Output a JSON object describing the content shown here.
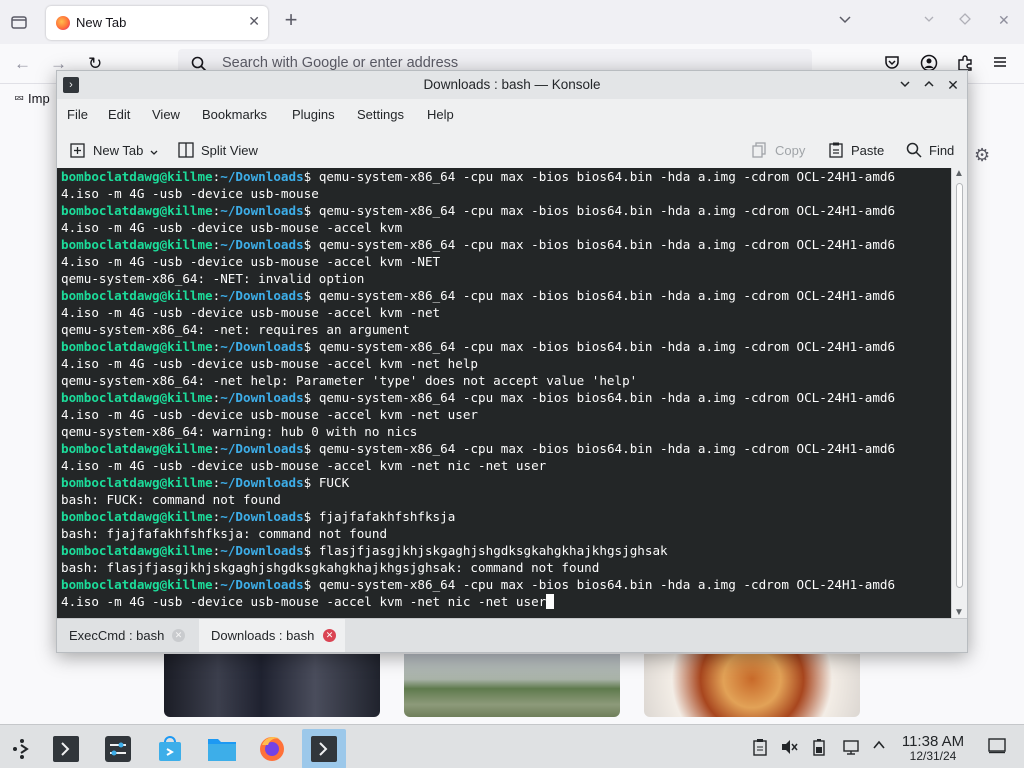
{
  "firefox": {
    "tab_title": "New Tab",
    "url_placeholder": "Search with Google or enter address",
    "bookmark_partial": "Imp"
  },
  "konsole": {
    "title": "Downloads : bash — Konsole",
    "menu": [
      "File",
      "Edit",
      "View",
      "Bookmarks",
      "Plugins",
      "Settings",
      "Help"
    ],
    "toolbar": {
      "new_tab": "New Tab",
      "split_view": "Split View",
      "copy": "Copy",
      "paste": "Paste",
      "find": "Find"
    },
    "prompt": {
      "user_host": "bomboclatdawg@killme",
      "colon": ":",
      "path": "~/Downloads",
      "dollar": "$ "
    },
    "terminal_lines": [
      {
        "type": "prompt",
        "text": "qemu-system-x86_64 -cpu max -bios bios64.bin -hda a.img -cdrom OCL-24H1-amd6"
      },
      {
        "type": "output",
        "text": "4.iso -m 4G -usb -device usb-mouse"
      },
      {
        "type": "prompt",
        "text": "qemu-system-x86_64 -cpu max -bios bios64.bin -hda a.img -cdrom OCL-24H1-amd6"
      },
      {
        "type": "output",
        "text": "4.iso -m 4G -usb -device usb-mouse -accel kvm"
      },
      {
        "type": "prompt",
        "text": "qemu-system-x86_64 -cpu max -bios bios64.bin -hda a.img -cdrom OCL-24H1-amd6"
      },
      {
        "type": "output",
        "text": "4.iso -m 4G -usb -device usb-mouse -accel kvm -NET"
      },
      {
        "type": "output",
        "text": "qemu-system-x86_64: -NET: invalid option"
      },
      {
        "type": "prompt",
        "text": "qemu-system-x86_64 -cpu max -bios bios64.bin -hda a.img -cdrom OCL-24H1-amd6"
      },
      {
        "type": "output",
        "text": "4.iso -m 4G -usb -device usb-mouse -accel kvm -net"
      },
      {
        "type": "output",
        "text": "qemu-system-x86_64: -net: requires an argument"
      },
      {
        "type": "prompt",
        "text": "qemu-system-x86_64 -cpu max -bios bios64.bin -hda a.img -cdrom OCL-24H1-amd6"
      },
      {
        "type": "output",
        "text": "4.iso -m 4G -usb -device usb-mouse -accel kvm -net help"
      },
      {
        "type": "output",
        "text": "qemu-system-x86_64: -net help: Parameter 'type' does not accept value 'help'"
      },
      {
        "type": "prompt",
        "text": "qemu-system-x86_64 -cpu max -bios bios64.bin -hda a.img -cdrom OCL-24H1-amd6"
      },
      {
        "type": "output",
        "text": "4.iso -m 4G -usb -device usb-mouse -accel kvm -net user"
      },
      {
        "type": "output",
        "text": "qemu-system-x86_64: warning: hub 0 with no nics"
      },
      {
        "type": "prompt",
        "text": "qemu-system-x86_64 -cpu max -bios bios64.bin -hda a.img -cdrom OCL-24H1-amd6"
      },
      {
        "type": "output",
        "text": "4.iso -m 4G -usb -device usb-mouse -accel kvm -net nic -net user"
      },
      {
        "type": "prompt",
        "text": "FUCK"
      },
      {
        "type": "output",
        "text": "bash: FUCK: command not found"
      },
      {
        "type": "prompt",
        "text": "fjajfafakhfshfksja"
      },
      {
        "type": "output",
        "text": "bash: fjajfafakhfshfksja: command not found"
      },
      {
        "type": "prompt",
        "text": "flasjfjasgjkhjskgaghjshgdksgkahgkhajkhgsjghsak"
      },
      {
        "type": "output",
        "text": "bash: flasjfjasgjkhjskgaghjshgdksgkahgkhajkhgsjghsak: command not found"
      },
      {
        "type": "prompt",
        "text": "qemu-system-x86_64 -cpu max -bios bios64.bin -hda a.img -cdrom OCL-24H1-amd6"
      },
      {
        "type": "output",
        "text": "4.iso -m 4G -usb -device usb-mouse -accel kvm -net nic -net user",
        "cursor": true
      }
    ],
    "tabs": [
      {
        "label": "ExecCmd : bash",
        "active": false
      },
      {
        "label": "Downloads : bash",
        "active": true
      }
    ]
  },
  "panel": {
    "clock_time": "11:38 AM",
    "clock_date": "12/31/24",
    "tasks": [
      "application-launcher-icon",
      "konsole-icon",
      "system-settings-icon",
      "discover-store-icon",
      "dolphin-files-icon",
      "firefox-icon",
      "konsole-running-icon"
    ]
  },
  "colors": {
    "terminal_bg": "#232627",
    "prompt_user": "#1cdc9a",
    "prompt_path": "#3daee9",
    "accent": "#3daee9",
    "close_active": "#da4453"
  }
}
